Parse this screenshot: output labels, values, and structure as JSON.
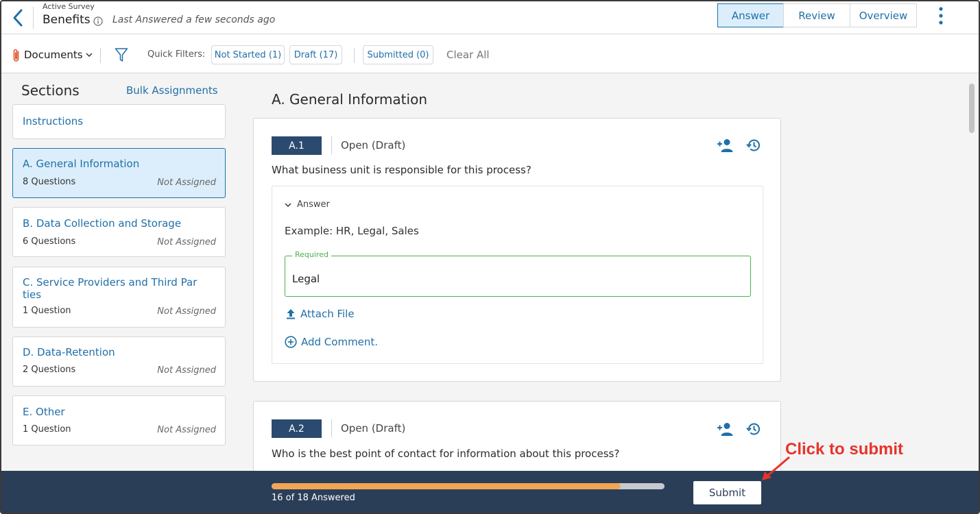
{
  "header": {
    "supertitle": "Active Survey",
    "title": "Benefits",
    "last_answered": "Last Answered a few seconds ago",
    "tabs": [
      {
        "label": "Answer",
        "active": true
      },
      {
        "label": "Review",
        "active": false
      },
      {
        "label": "Overview",
        "active": false
      }
    ]
  },
  "filters": {
    "documents_label": "Documents",
    "quick_filters_label": "Quick Filters:",
    "chips": [
      "Not Started (1)",
      "Draft (17)",
      "Submitted (0)"
    ],
    "clear_all": "Clear All"
  },
  "sidebar": {
    "title": "Sections",
    "bulk_label": "Bulk Assignments",
    "instructions": "Instructions",
    "sections": [
      {
        "name": "A. General Information",
        "count": "8 Questions",
        "assignee": "Not Assigned",
        "active": true
      },
      {
        "name": "B. Data Collection and Storage",
        "count": "6 Questions",
        "assignee": "Not Assigned",
        "active": false
      },
      {
        "name": "C. Service Providers and Third Par ties",
        "count": "1 Question",
        "assignee": "Not Assigned",
        "active": false
      },
      {
        "name": "D. Data-Retention",
        "count": "2 Questions",
        "assignee": "Not Assigned",
        "active": false
      },
      {
        "name": "E. Other",
        "count": "1 Question",
        "assignee": "Not Assigned",
        "active": false
      }
    ]
  },
  "main": {
    "section_title": "A. General Information",
    "questions": [
      {
        "id": "A.1",
        "status": "Open (Draft)",
        "text": "What business unit is responsible for this process?",
        "answer_toggle": "Answer",
        "example": "Example: HR, Legal, Sales",
        "field_label": "Required",
        "field_value": "Legal",
        "attach_label": "Attach File",
        "comment_label": "Add Comment."
      },
      {
        "id": "A.2",
        "status": "Open (Draft)",
        "text": "Who is the best point of contact for information about this process?"
      }
    ]
  },
  "footer": {
    "progress_text": "16 of 18 Answered",
    "progress_fraction": 0.889,
    "submit_label": "Submit"
  },
  "annotation": {
    "text": "Click to submit"
  },
  "colors": {
    "accent": "#1f6fa8",
    "footer_bg": "#2b3e58",
    "progress_fill": "#f2a654",
    "badge_bg": "#2b4a6f",
    "annotation": "#e8332a",
    "field_border": "#4caf50"
  }
}
